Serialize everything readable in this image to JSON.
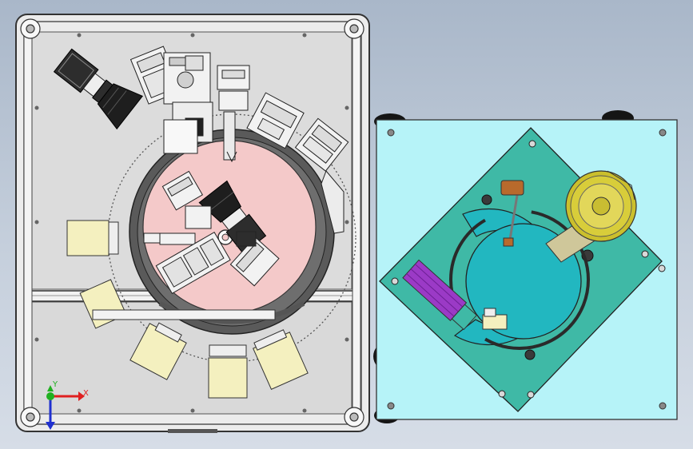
{
  "view": {
    "background_top": "#a9b7c9",
    "background_bottom": "#d6dde7"
  },
  "triad": {
    "x_label": "X",
    "y_label": "Y",
    "x_color": "#e02020",
    "y_color": "#20b020",
    "z_color": "#2030d0"
  },
  "left_assembly": {
    "frame_color": "#e9e9e9",
    "panel_color": "#dcdcdc",
    "turntable_color": "#f4c9c9",
    "ring_color": "#5a5a5a",
    "fixture_color": "#f4f0bf"
  },
  "right_assembly": {
    "base_color": "#b6f3f8",
    "plate_color": "#3fb9a6",
    "disc_color": "#22b7c0",
    "bowl_color": "#d8cd3a",
    "arm_color": "#cfc79a",
    "chute_color": "#9b3ac6",
    "pin_color": "#b86a2c"
  }
}
